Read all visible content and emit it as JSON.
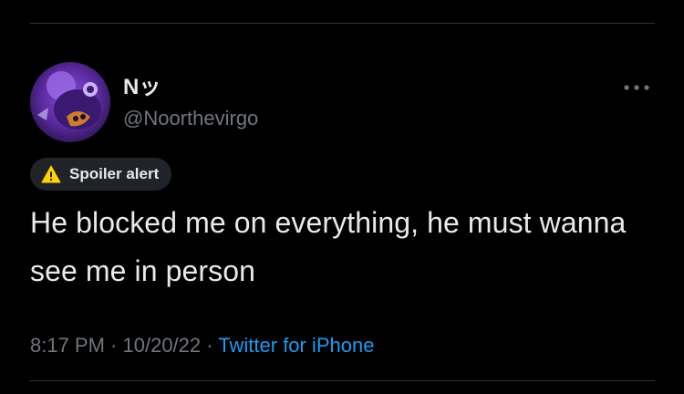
{
  "tweet": {
    "display_name": "Nッ",
    "handle": "@Noorthevirgo",
    "spoiler_label": "Spoiler alert",
    "text": "He blocked me on everything, he must wanna see me in person",
    "time": "8:17 PM",
    "separator_1": " · ",
    "date": "10/20/22",
    "separator_2": " · ",
    "source": "Twitter for iPhone"
  },
  "icons": {
    "avatar": "avatar-photo",
    "more": "more-horizontal-icon",
    "warning": "warning-triangle-icon"
  },
  "colors": {
    "background": "#000000",
    "text_primary": "#e7e9ea",
    "text_secondary": "#71767b",
    "link": "#1d9bf0",
    "badge_bg": "#202327",
    "warning": "#ffd400",
    "divider": "#2f3336"
  }
}
